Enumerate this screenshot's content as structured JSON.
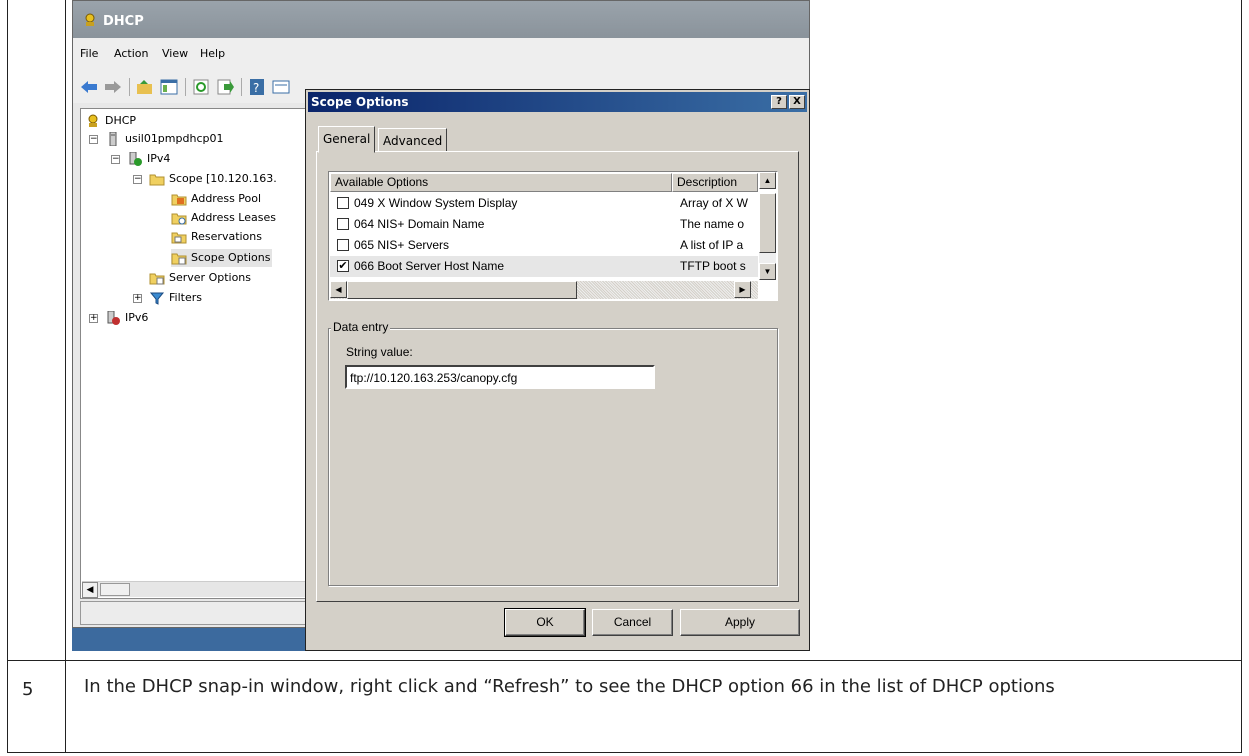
{
  "step": {
    "number": "5",
    "text": "In the DHCP snap-in window, right click and “Refresh” to see the DHCP option 66 in the list of DHCP options"
  },
  "mmc": {
    "title": "DHCP",
    "menu": [
      "File",
      "Action",
      "View",
      "Help"
    ],
    "toolbar_icons": [
      "back-icon",
      "forward-icon",
      "up-folder-icon",
      "show-hide-tree-icon",
      "refresh-icon",
      "export-icon",
      "help-icon",
      "properties-icon"
    ],
    "tree": {
      "root": "DHCP",
      "server": "usil01pmpdhcp01",
      "ipv4": "IPv4",
      "scope": "Scope [10.120.163.",
      "address_pool": "Address Pool",
      "address_leases": "Address Leases",
      "reservations": "Reservations",
      "scope_options": "Scope Options",
      "server_options": "Server Options",
      "filters": "Filters",
      "ipv6": "IPv6"
    }
  },
  "dialog": {
    "title": "Scope Options",
    "help_btn": "?",
    "close_btn": "X",
    "tabs": [
      "General",
      "Advanced"
    ],
    "list": {
      "col_options": "Available Options",
      "col_description": "Description",
      "rows": [
        {
          "checked": false,
          "name": "049 X Window System Display",
          "desc": "Array of X W"
        },
        {
          "checked": false,
          "name": "064 NIS+ Domain Name",
          "desc": "The name o"
        },
        {
          "checked": false,
          "name": "065 NIS+ Servers",
          "desc": "A list of IP a"
        },
        {
          "checked": true,
          "name": "066 Boot Server Host Name",
          "desc": "TFTP boot s"
        }
      ]
    },
    "data_entry": {
      "label": "Data entry",
      "string_label": "String value:",
      "string_value": "ftp://10.120.163.253/canopy.cfg"
    },
    "buttons": {
      "ok": "OK",
      "cancel": "Cancel",
      "apply": "Apply"
    }
  },
  "colors": {
    "title_bar": "#0a246a",
    "taskbar": "#3c6a9e",
    "dialog_face": "#d4d0c8"
  }
}
